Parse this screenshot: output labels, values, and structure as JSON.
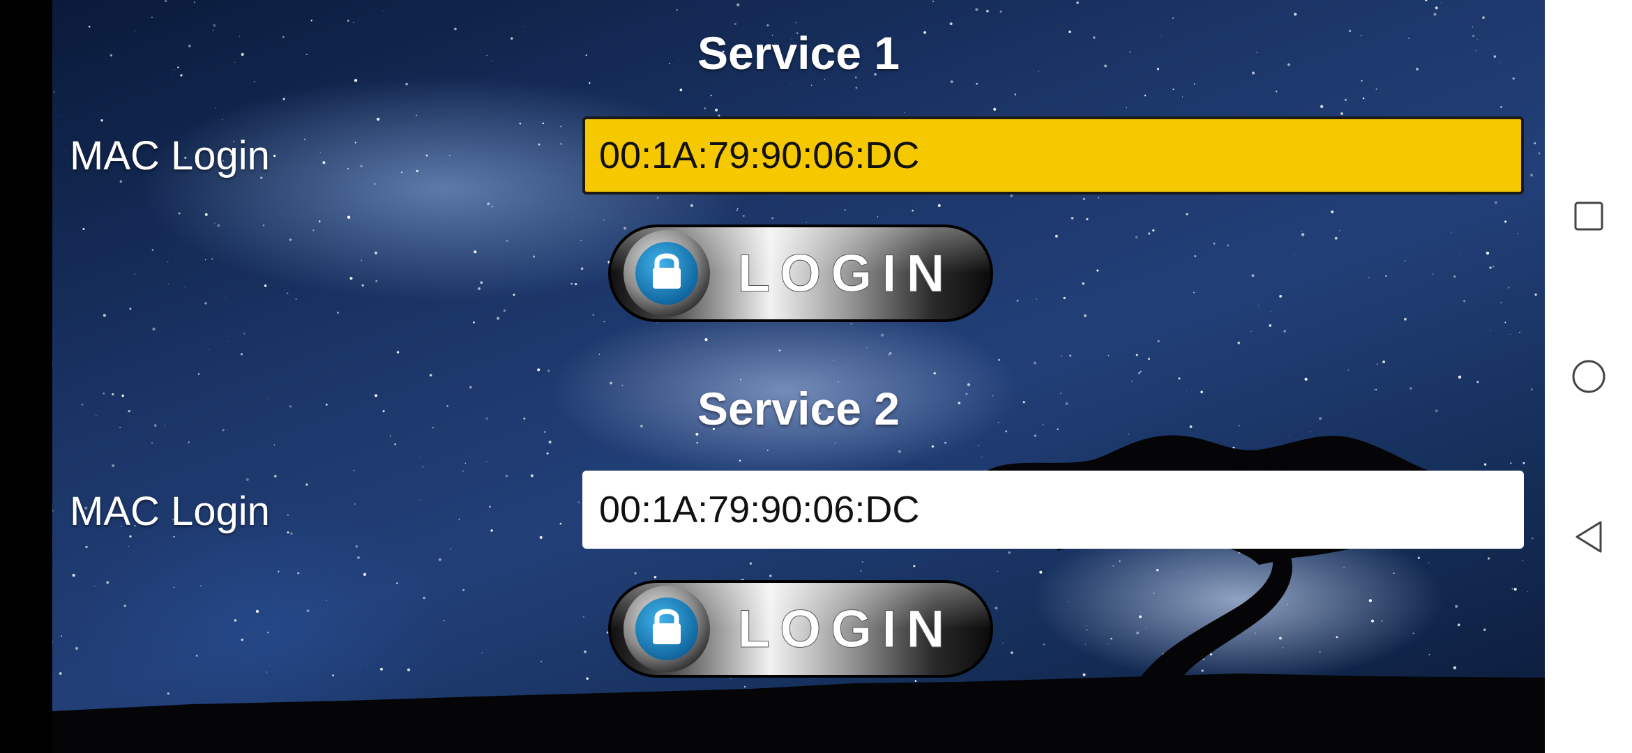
{
  "services": [
    {
      "title": "Service 1",
      "label": "MAC Login",
      "mac": "00:1A:79:90:06:DC",
      "button_label": "LOGIN",
      "focused": true
    },
    {
      "title": "Service 2",
      "label": "MAC Login",
      "mac": "00:1A:79:90:06:DC",
      "button_label": "LOGIN",
      "focused": false
    }
  ],
  "colors": {
    "focused_field": "#f5c800",
    "idle_field": "#ffffff",
    "lock_blue": "#1e8fcf"
  },
  "nav": {
    "icons": [
      "recents-square-icon",
      "home-circle-icon",
      "back-triangle-icon"
    ]
  }
}
